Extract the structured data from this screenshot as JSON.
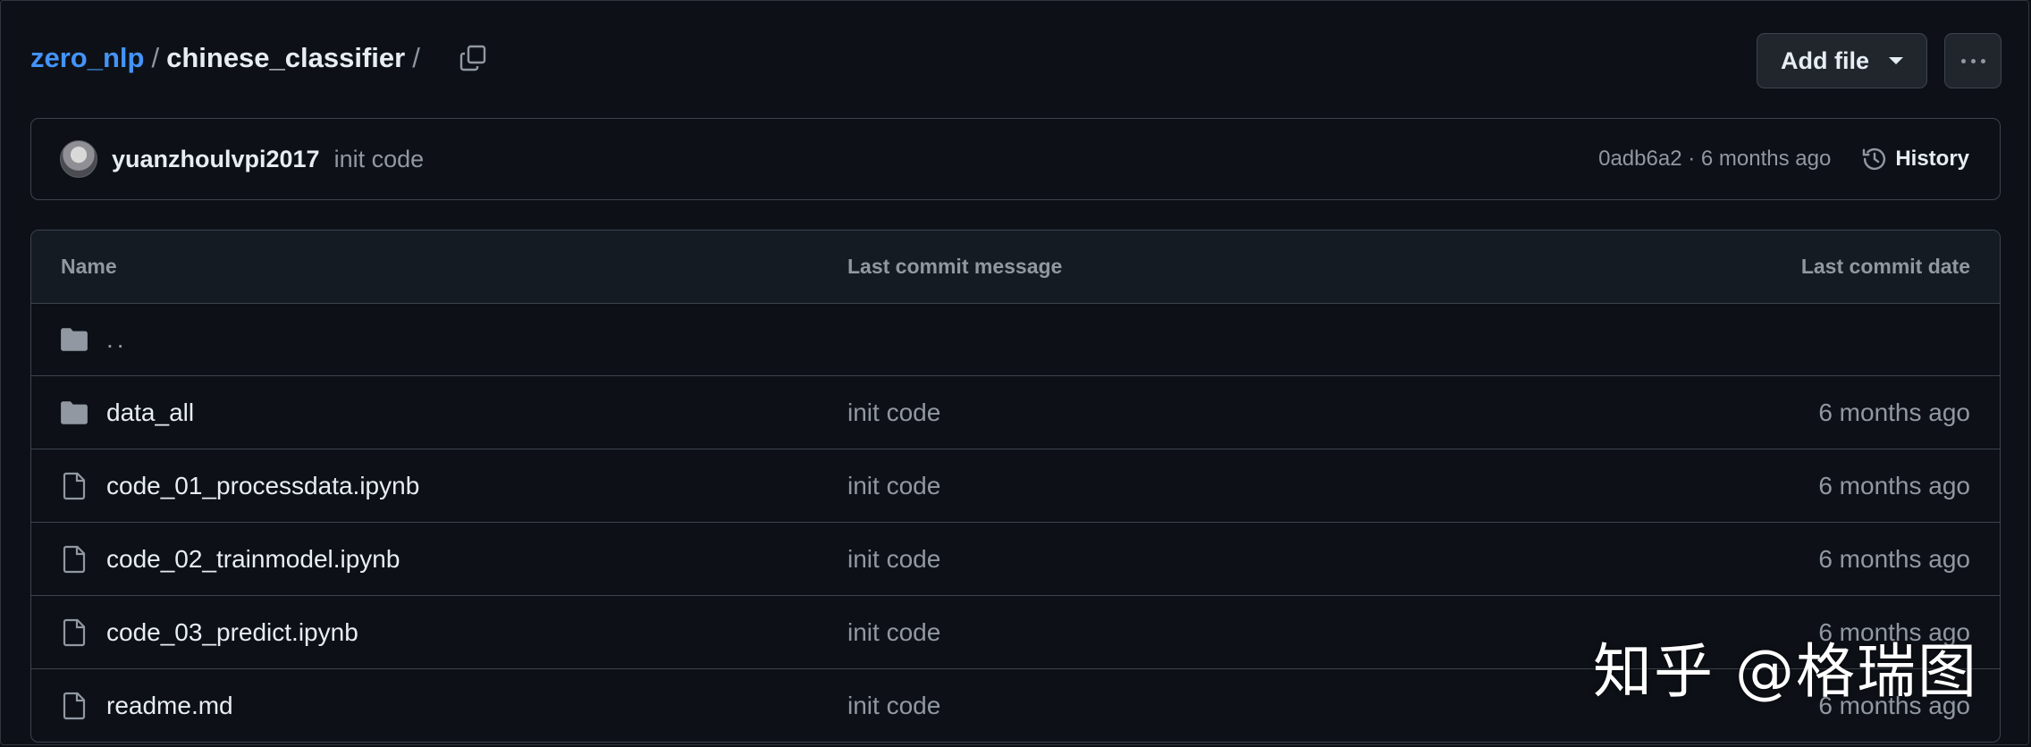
{
  "breadcrumb": {
    "repo": "zero_nlp",
    "separator": "/",
    "folder": "chinese_classifier",
    "trailing_separator": "/"
  },
  "actions": {
    "add_file_label": "Add file",
    "more_icon": "kebab-horizontal-icon"
  },
  "commit": {
    "author": "yuanzhoulvpi2017",
    "message": "init code",
    "meta": "0adb6a2 · 6 months ago",
    "history_label": "History"
  },
  "table": {
    "headers": {
      "name": "Name",
      "message": "Last commit message",
      "date": "Last commit date"
    },
    "parent_dir": "..",
    "rows": [
      {
        "name": "data_all",
        "type": "folder",
        "message": "init code",
        "date": "6 months ago"
      },
      {
        "name": "code_01_processdata.ipynb",
        "type": "file",
        "message": "init code",
        "date": "6 months ago"
      },
      {
        "name": "code_02_trainmodel.ipynb",
        "type": "file",
        "message": "init code",
        "date": "6 months ago"
      },
      {
        "name": "code_03_predict.ipynb",
        "type": "file",
        "message": "init code",
        "date": "6 months ago"
      },
      {
        "name": "readme.md",
        "type": "file",
        "message": "init code",
        "date": "6 months ago"
      }
    ]
  },
  "watermark": "知乎 @格瑞图",
  "colors": {
    "background": "#0d1117",
    "link": "#4493f8",
    "muted": "#9198a1",
    "border": "#3d444d"
  }
}
